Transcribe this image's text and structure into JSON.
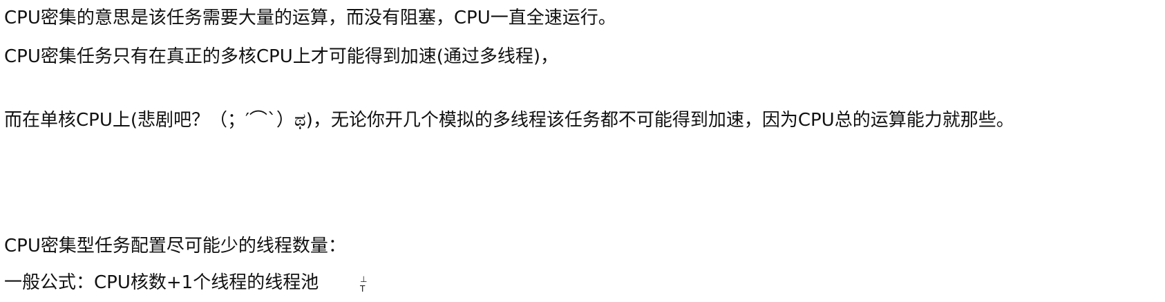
{
  "lines": [
    "CPU密集的意思是该任务需要大量的运算，而没有阻塞，CPU一直全速运行。",
    "CPU密集任务只有在真正的多核CPU上才可能得到加速(通过多线程)，",
    "而在单核CPU上(悲剧吧？（；′⌒`）ಥ)，无论你开几个模拟的多线程该任务都不可能得到加速，因为CPU总的运算能力就那些。",
    "CPU密集型任务配置尽可能少的线程数量：",
    "一般公式：CPU核数+1个线程的线程池"
  ],
  "cursor_mark": {
    "top": "⊥",
    "bottom": "T"
  }
}
